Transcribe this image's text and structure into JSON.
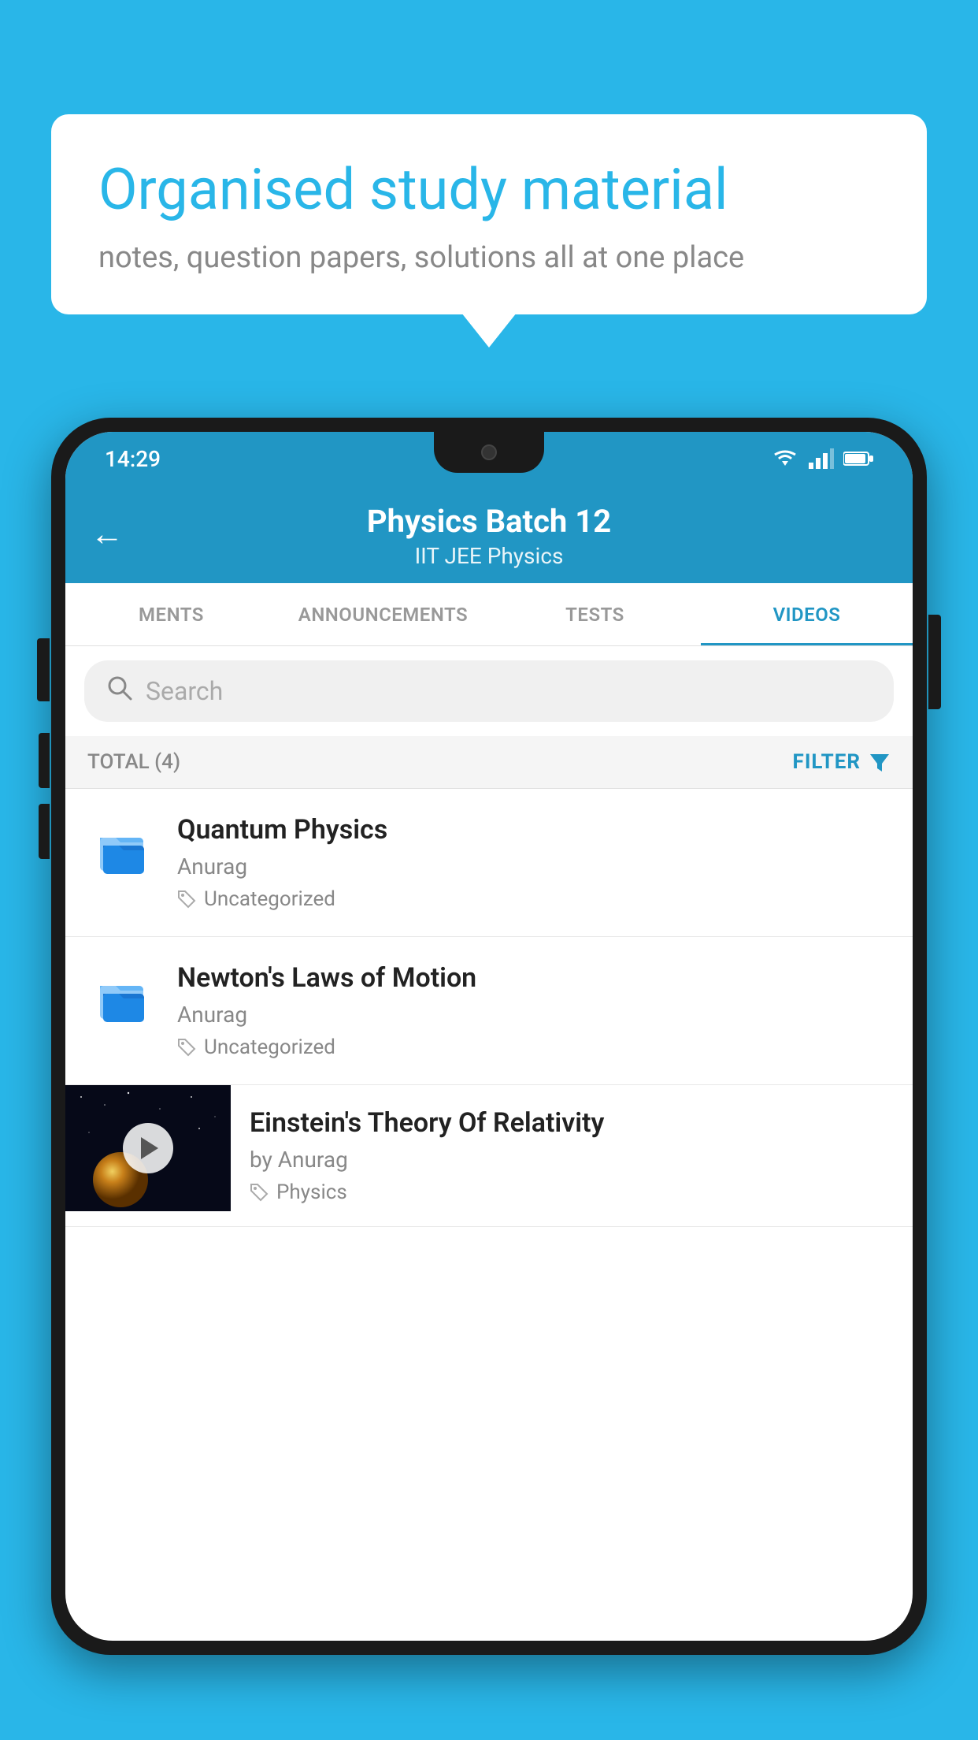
{
  "background": {
    "color": "#29b6e8"
  },
  "speech_bubble": {
    "title": "Organised study material",
    "subtitle": "notes, question papers, solutions all at one place"
  },
  "status_bar": {
    "time": "14:29",
    "wifi": "▼▲",
    "battery": "▮"
  },
  "app_header": {
    "back_label": "←",
    "title": "Physics Batch 12",
    "subtitle": "IIT JEE    Physics"
  },
  "tabs": [
    {
      "label": "MENTS",
      "active": false
    },
    {
      "label": "ANNOUNCEMENTS",
      "active": false
    },
    {
      "label": "TESTS",
      "active": false
    },
    {
      "label": "VIDEOS",
      "active": true
    }
  ],
  "search": {
    "placeholder": "Search"
  },
  "filter_bar": {
    "total_label": "TOTAL (4)",
    "filter_label": "FILTER"
  },
  "videos": [
    {
      "id": 1,
      "title": "Quantum Physics",
      "author": "Anurag",
      "tag": "Uncategorized",
      "has_thumbnail": false
    },
    {
      "id": 2,
      "title": "Newton's Laws of Motion",
      "author": "Anurag",
      "tag": "Uncategorized",
      "has_thumbnail": false
    },
    {
      "id": 3,
      "title": "Einstein's Theory Of Relativity",
      "author": "by Anurag",
      "tag": "Physics",
      "has_thumbnail": true
    }
  ]
}
